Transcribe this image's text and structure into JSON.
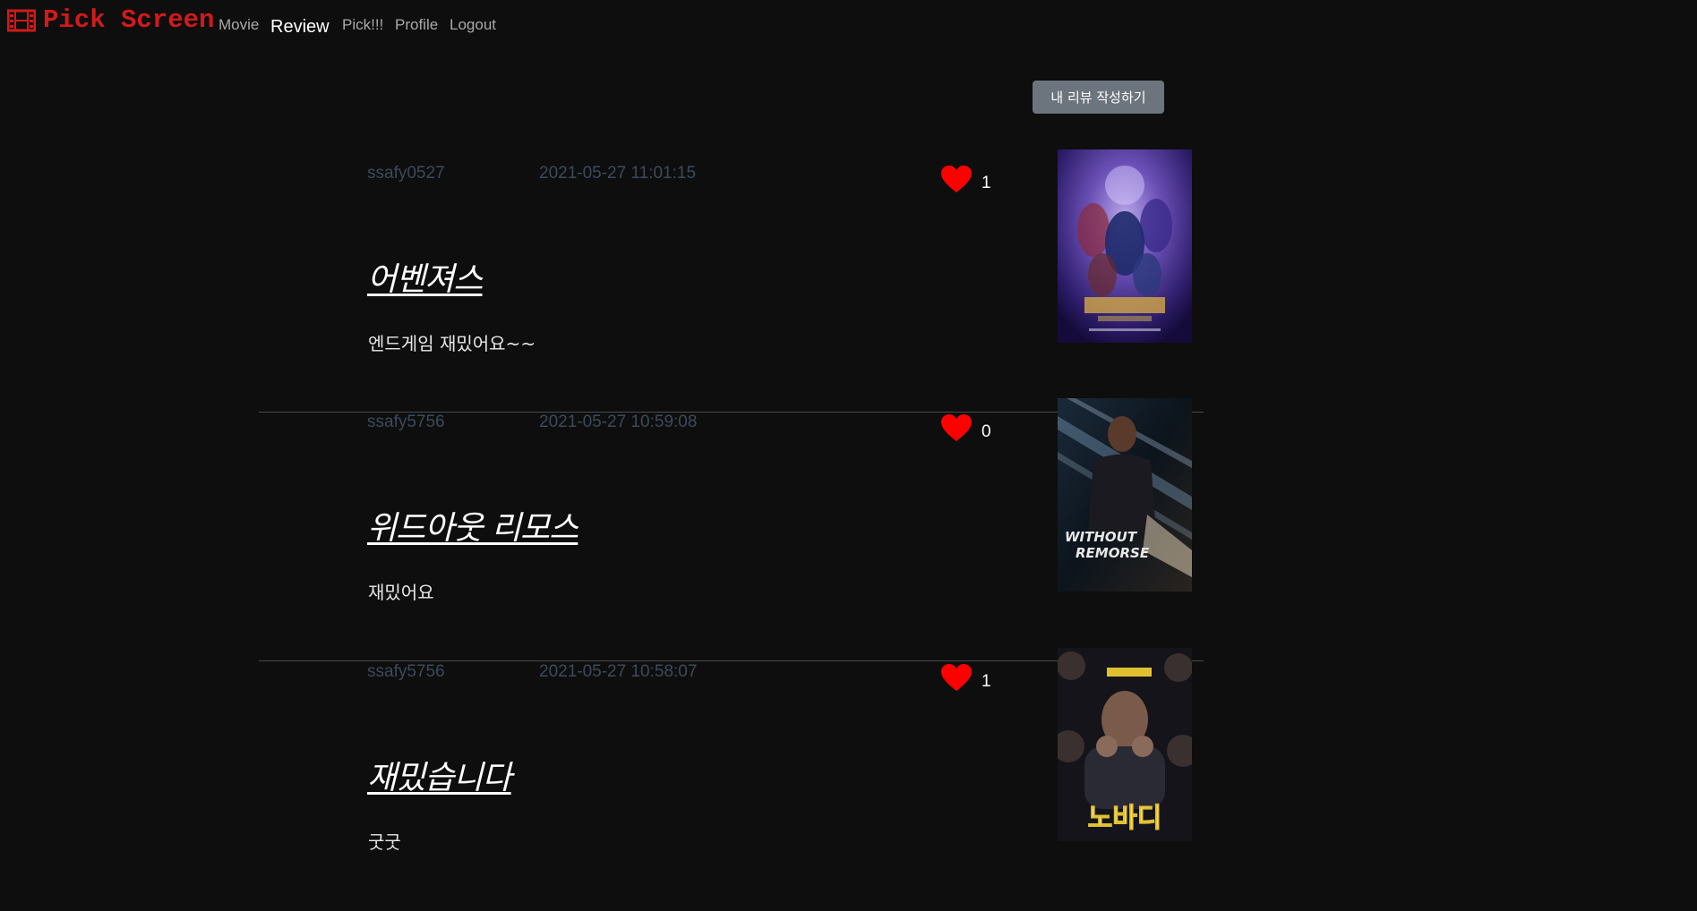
{
  "nav": {
    "brand": "Pick Screen",
    "links": [
      "Movie",
      "Review",
      "Pick!!!",
      "Profile",
      "Logout"
    ],
    "active": "Review"
  },
  "actions": {
    "write_review": "내 리뷰 작성하기"
  },
  "reviews": [
    {
      "author": "ssafy0527",
      "date": "2021-05-27 11:01:15",
      "likes": "1",
      "title": "어벤져스",
      "content": "엔드게임 재밌어요~~",
      "poster": "avengers-endgame-poster"
    },
    {
      "author": "ssafy5756",
      "date": "2021-05-27 10:59:08",
      "likes": "0",
      "title": "위드아웃 리모스",
      "content": "재밌어요",
      "poster": "without-remorse-poster",
      "poster_text": "WITHOUT REMORSE"
    },
    {
      "author": "ssafy5756",
      "date": "2021-05-27 10:58:07",
      "likes": "1",
      "title": "재밌습니다",
      "content": "굿굿",
      "poster": "nobody-poster",
      "poster_text": "노바디"
    }
  ],
  "colors": {
    "background": "#0e0e0e",
    "brand": "#d11a1a",
    "heart": "#ff0000",
    "meta_text": "#3b4a5c",
    "button": "#6c757d"
  }
}
